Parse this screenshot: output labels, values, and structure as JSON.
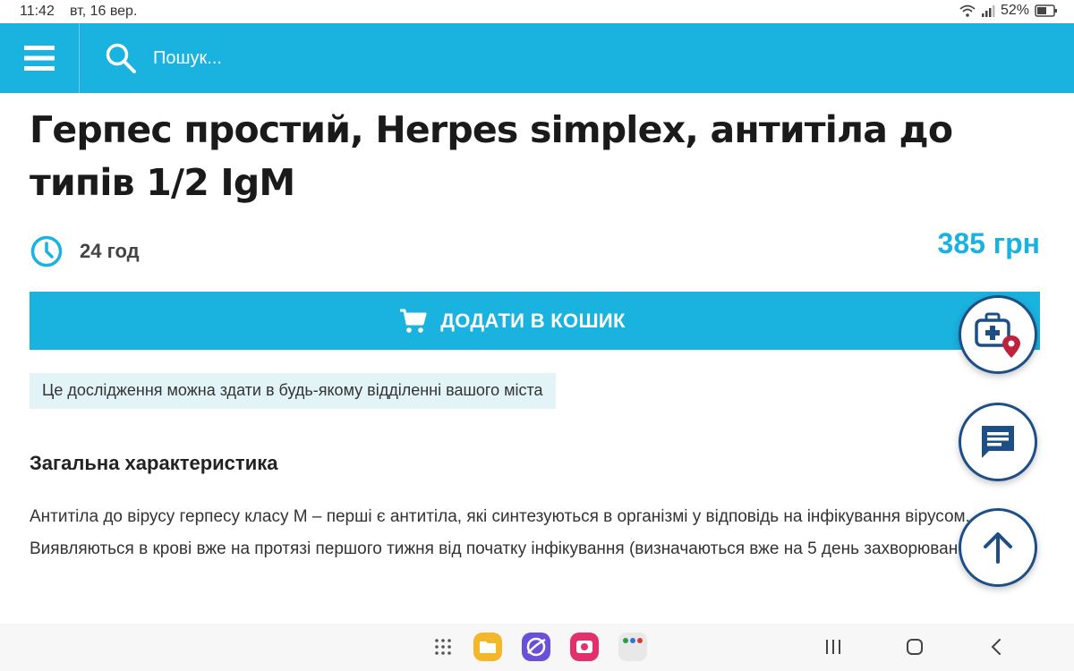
{
  "status_bar": {
    "time": "11:42",
    "date": "вт, 16 вер.",
    "battery": "52%"
  },
  "app_bar": {
    "search_placeholder": "Пошук...",
    "color": "#1ab2df"
  },
  "product": {
    "title": "Герпес простий, Herpes simplex, антитіла до типів 1/2 IgM",
    "duration": "24 год",
    "price": "385 грн",
    "add_to_cart": "ДОДАТИ В КОШИК",
    "notice": "Це дослідження можна здати в будь-якому відділенні вашого міста"
  },
  "section": {
    "heading": "Загальна характеристика",
    "paragraph_1": "Антитіла до вірусу герпесу класу М – перші є антитіла, які синтезуються в організмі у відповідь на інфікування вірусом.",
    "paragraph_2": "Виявляються в крові вже на протязі першого тижня від початку інфікування (визначаються вже на 5 день захворювання)."
  },
  "floating_buttons": [
    "clinic-location-icon",
    "chat-icon",
    "arrow-up-icon"
  ],
  "nav_bar": {
    "apps": [
      "app-drawer-icon",
      "files-app-icon",
      "browser-app-icon",
      "camera-app-icon",
      "multi-app-icon"
    ],
    "system": [
      "recents-icon",
      "home-icon",
      "back-icon"
    ]
  },
  "colors": {
    "accent": "#1ab2df",
    "fab_border": "#1d4f86",
    "notice_bg": "#e3f4f9",
    "location_pin": "#c0223b"
  }
}
